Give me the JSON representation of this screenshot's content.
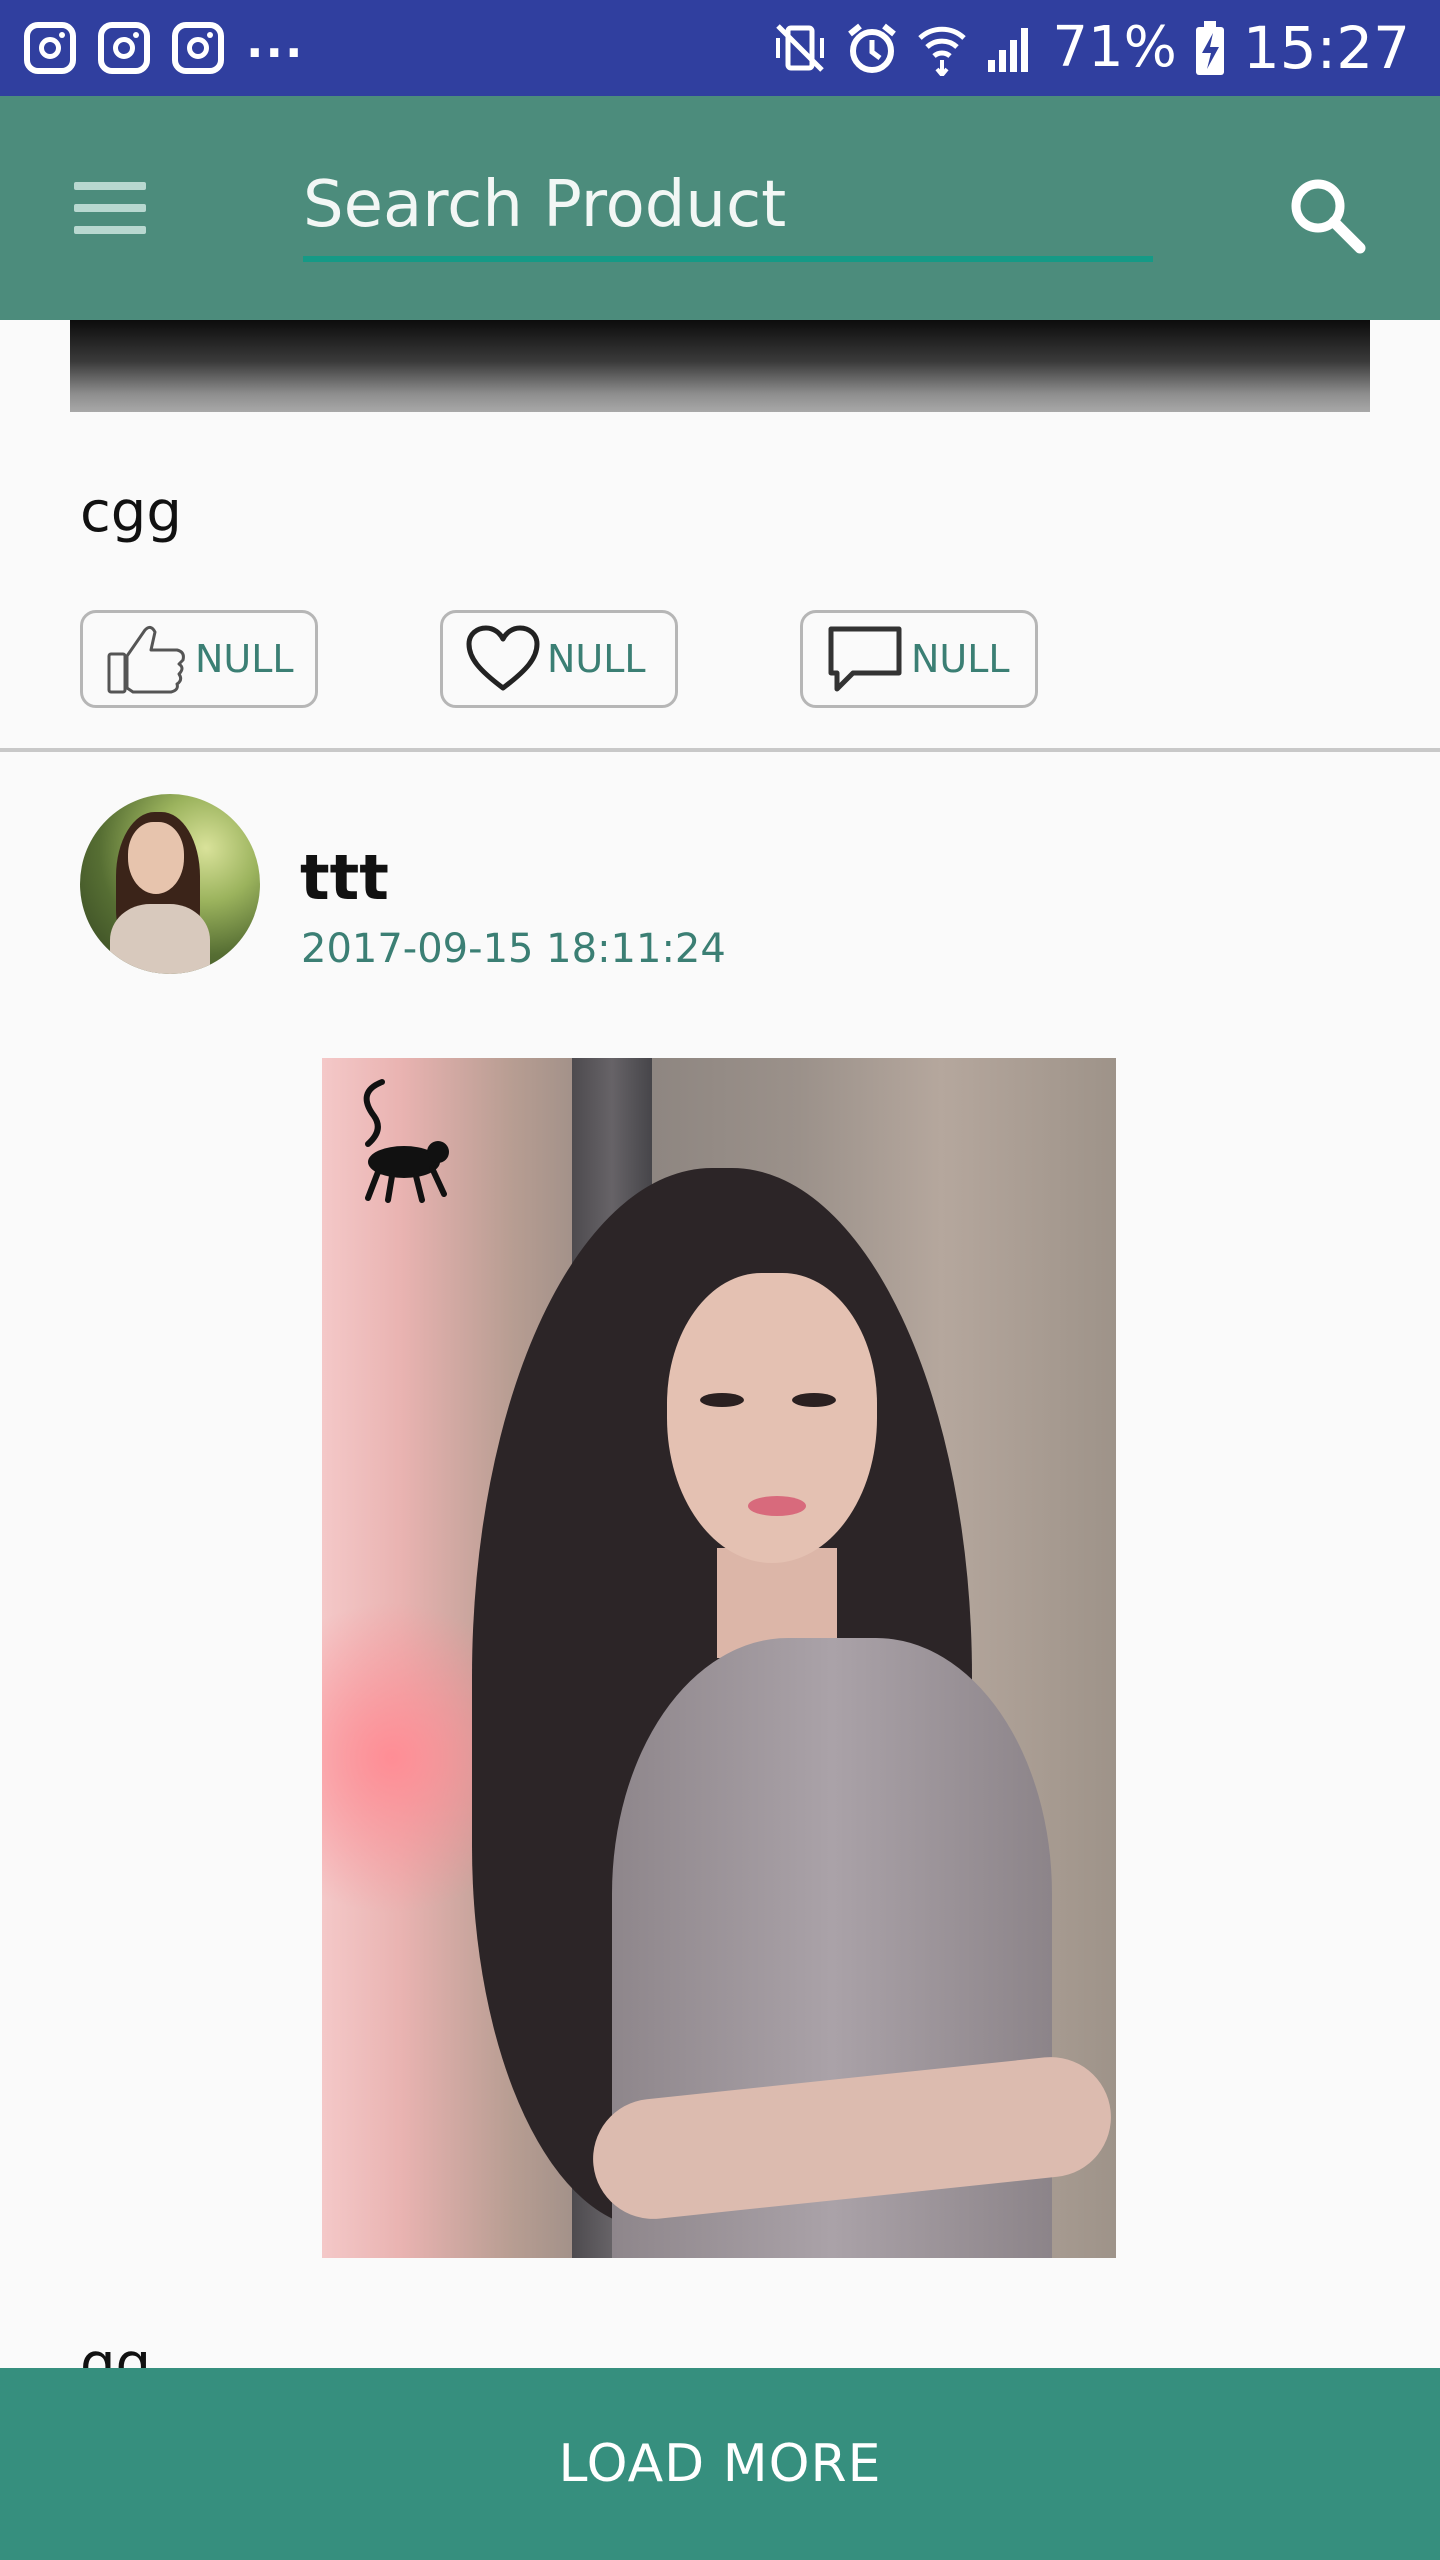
{
  "status_bar": {
    "more": "...",
    "battery_percent": "71%",
    "time": "15:27",
    "icons": [
      "instagram-icon",
      "instagram-icon",
      "instagram-icon",
      "vibrate-mute-icon",
      "alarm-icon",
      "wifi-icon",
      "signal-icon",
      "battery-charging-icon"
    ]
  },
  "app_bar": {
    "search_placeholder": "Search Product",
    "menu_icon": "menu-icon",
    "search_icon": "search-icon",
    "color": "#4c8c7c"
  },
  "feed": {
    "previous_post": {
      "caption": "cgg",
      "actions": [
        {
          "icon": "thumbs-up-icon",
          "label": "NULL"
        },
        {
          "icon": "heart-icon",
          "label": "NULL"
        },
        {
          "icon": "comment-icon",
          "label": "NULL"
        }
      ]
    },
    "post": {
      "user_name": "ttt",
      "timestamp": "2017-09-15 18:11:24",
      "next_caption": "gg"
    }
  },
  "load_more": {
    "label": "LOAD MORE",
    "color": "#368f7e"
  }
}
